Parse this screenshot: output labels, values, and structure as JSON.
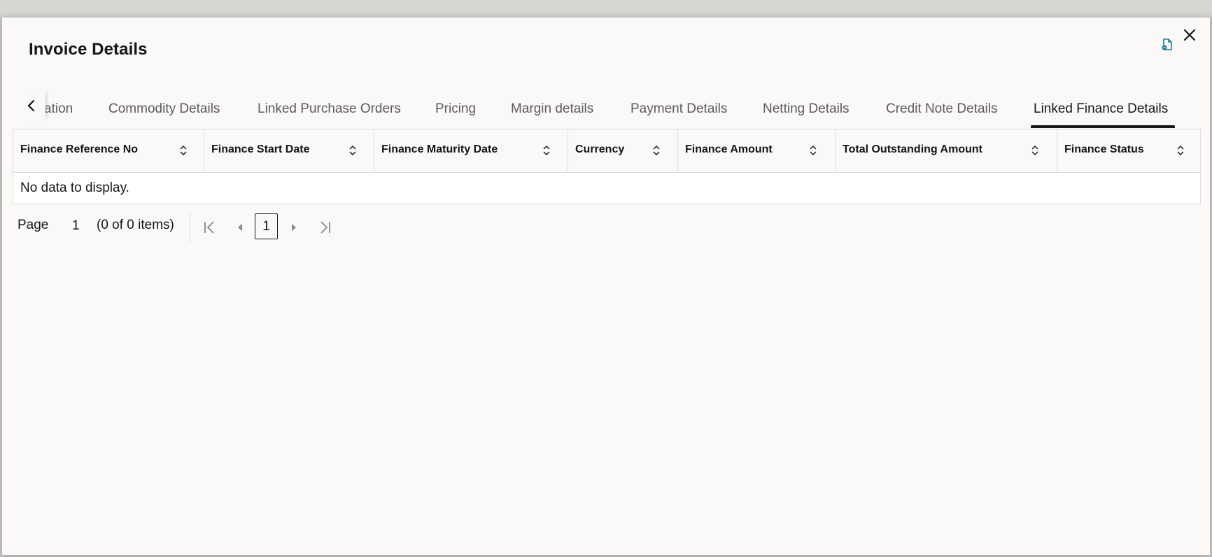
{
  "dialog": {
    "title": "Invoice Details",
    "close_icon": "close-icon",
    "document_icon": "document-icon"
  },
  "tabs": [
    {
      "label": "ation",
      "active": false
    },
    {
      "label": "Commodity Details",
      "active": false
    },
    {
      "label": "Linked Purchase Orders",
      "active": false
    },
    {
      "label": "Pricing",
      "active": false
    },
    {
      "label": "Margin details",
      "active": false
    },
    {
      "label": "Payment Details",
      "active": false
    },
    {
      "label": "Netting Details",
      "active": false
    },
    {
      "label": "Credit Note Details",
      "active": false
    },
    {
      "label": "Linked Finance Details",
      "active": true
    }
  ],
  "table": {
    "columns": [
      "Finance Reference No",
      "Finance Start Date",
      "Finance Maturity Date",
      "Currency",
      "Finance Amount",
      "Total Outstanding Amount",
      "Finance Status"
    ],
    "empty_message": "No data to display."
  },
  "pagination": {
    "page_label": "Page",
    "page_value": "1",
    "items_text": "(0 of 0 items)",
    "current_page": "1"
  },
  "colors": {
    "text": "#161513",
    "tab_inactive": "#5d5a57",
    "background": "#faf9f8",
    "border": "#e0ddd9",
    "accent_icon": "#227e9e"
  }
}
